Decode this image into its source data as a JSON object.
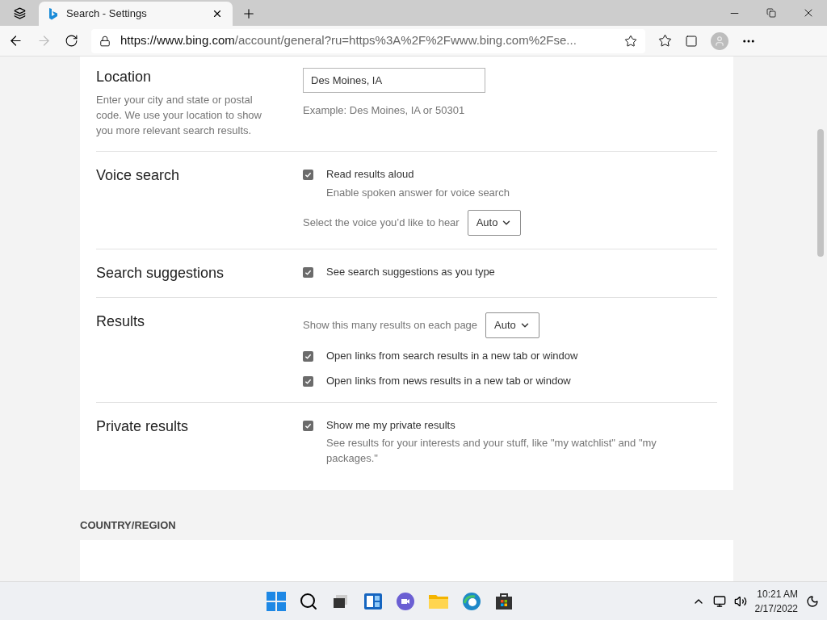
{
  "tabs": [
    {
      "title": "Search - Settings",
      "selected": true
    }
  ],
  "address": {
    "url_host": "https://www.bing.com",
    "url_path": "/account/general?ru=https%3A%2F%2Fwww.bing.com%2Fse..."
  },
  "sections": [
    {
      "title": "Location",
      "description": "Enter your city and state or postal code. We use your location to show you more relevant search results.",
      "items": [
        {
          "kind": "input",
          "value": "Des Moines, IA",
          "hint": "Example: Des Moines, IA or 50301"
        }
      ]
    },
    {
      "title": "Voice search",
      "items": [
        {
          "kind": "checkbox",
          "label": "Read results aloud",
          "sublabel": "Enable spoken answer for voice search",
          "checked": true
        },
        {
          "kind": "select",
          "label": "Select the voice you’d like to hear",
          "value": "Auto"
        }
      ]
    },
    {
      "title": "Search suggestions",
      "items": [
        {
          "kind": "checkbox",
          "label": "See search suggestions as you type",
          "checked": true
        }
      ]
    },
    {
      "title": "Results",
      "items": [
        {
          "kind": "select",
          "label": "Show this many results on each page",
          "value": "Auto"
        },
        {
          "kind": "checkbox",
          "label": "Open links from search results in a new tab or window",
          "checked": true
        },
        {
          "kind": "checkbox",
          "label": "Open links from news results in a new tab or window",
          "checked": true
        }
      ]
    },
    {
      "title": "Private results",
      "items": [
        {
          "kind": "checkbox",
          "label": "Show me my private results",
          "sublabel": "See results for your interests and your stuff, like \"my watchlist\" and \"my packages.\"",
          "checked": true
        }
      ]
    }
  ],
  "next_heading": "COUNTRY/REGION",
  "taskbar": {
    "time": "10:21 AM",
    "date": "2/17/2022"
  }
}
